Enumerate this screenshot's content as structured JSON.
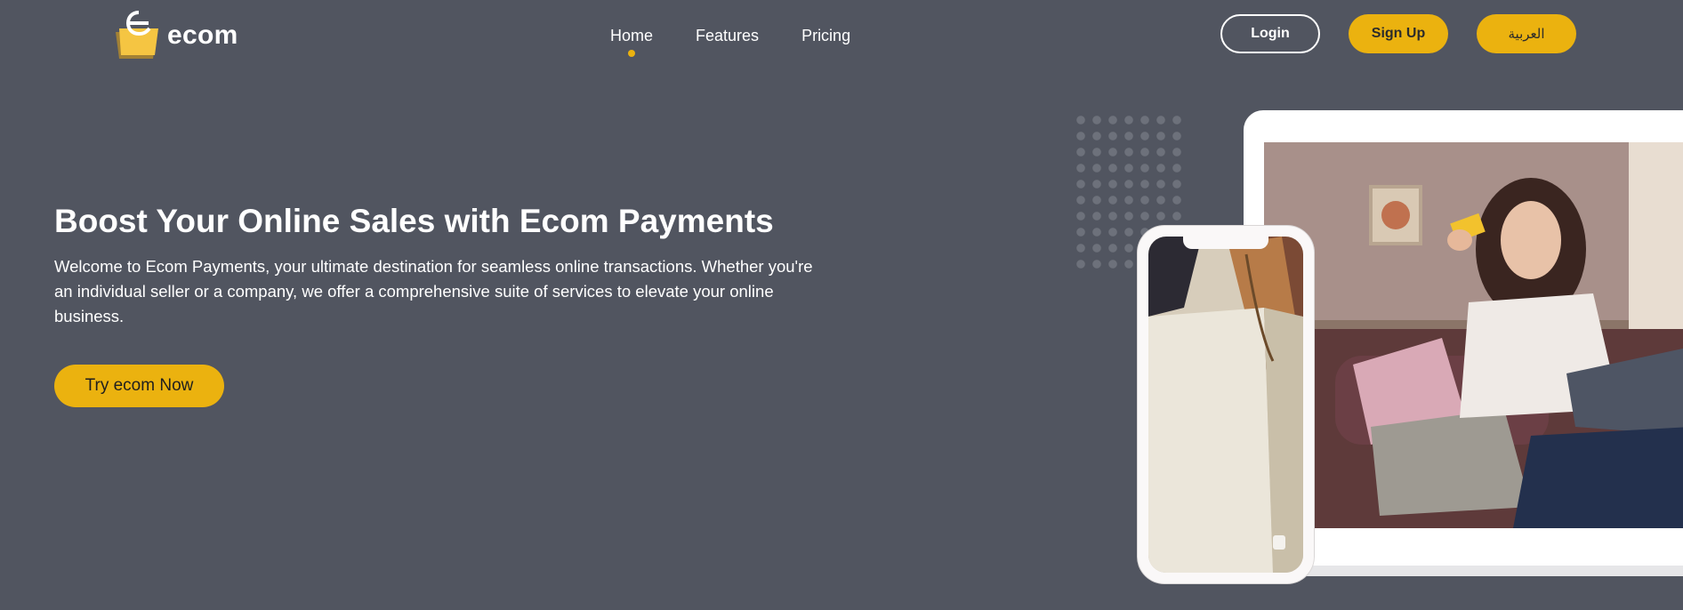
{
  "brand": {
    "name": "ecom",
    "logo_icon": "shopping-bag-icon",
    "accent": "#ebb20f"
  },
  "nav": {
    "items": [
      {
        "label": "Home",
        "active": true
      },
      {
        "label": "Features",
        "active": false
      },
      {
        "label": "Pricing",
        "active": false
      }
    ]
  },
  "header": {
    "login_label": "Login",
    "signup_label": "Sign Up",
    "language_label": "العربية"
  },
  "hero": {
    "title": "Boost Your Online Sales with Ecom Payments",
    "description": "Welcome to Ecom Payments, your ultimate destination for seamless online transactions. Whether you're an individual seller or a company, we offer a comprehensive suite of services to elevate your online business.",
    "cta_label": "Try ecom Now"
  },
  "colors": {
    "background": "#515560",
    "accent": "#ebb20f",
    "text": "#ffffff"
  },
  "media": {
    "laptop_image": "woman-shopping-with-card-photo",
    "phone_image": "shopping-bags-photo"
  }
}
